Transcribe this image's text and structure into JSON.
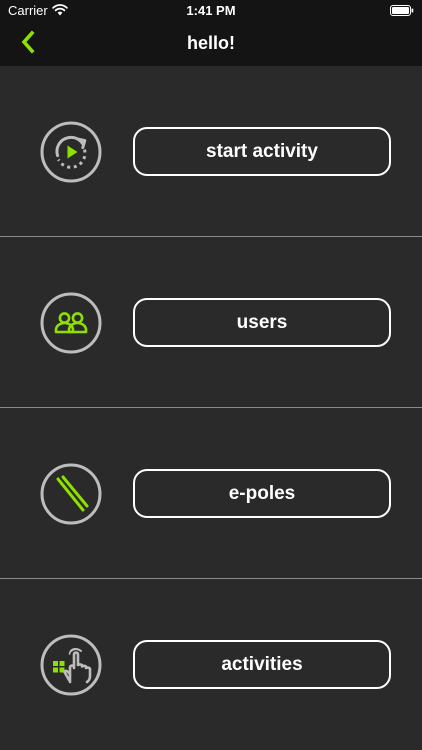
{
  "status_bar": {
    "carrier": "Carrier",
    "time": "1:41 PM"
  },
  "nav": {
    "title": "hello!"
  },
  "colors": {
    "accent": "#8ee000",
    "background": "#2a2a2a",
    "bar": "#141414",
    "icon_ring": "#bdbdbd",
    "text": "#ffffff"
  },
  "menu": {
    "items": [
      {
        "label": "start activity",
        "icon": "start-activity-icon"
      },
      {
        "label": "users",
        "icon": "users-icon"
      },
      {
        "label": "e-poles",
        "icon": "e-poles-icon"
      },
      {
        "label": "activities",
        "icon": "activities-icon"
      }
    ]
  }
}
